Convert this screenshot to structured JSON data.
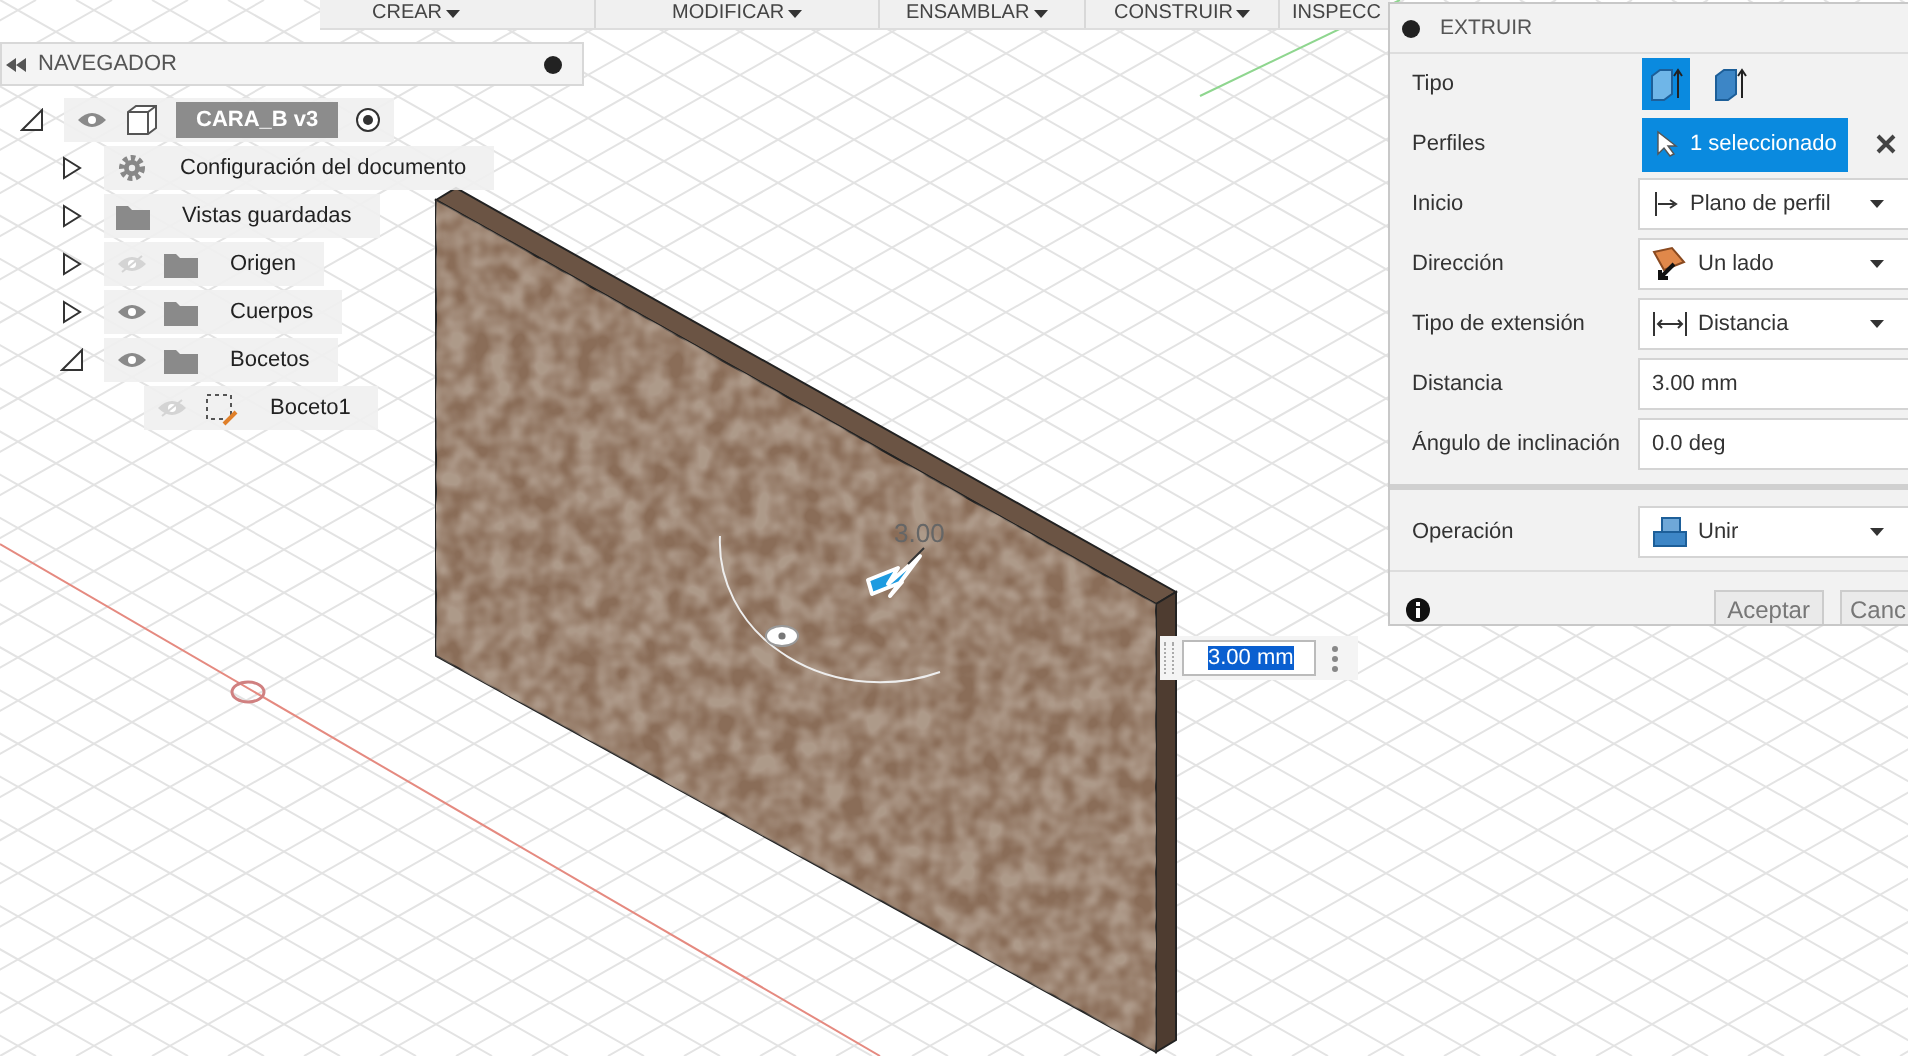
{
  "toolbar": {
    "menus": [
      {
        "label": "CREAR",
        "caret": true
      },
      {
        "label": "MODIFICAR",
        "caret": true
      },
      {
        "label": "ENSAMBLAR",
        "caret": true
      },
      {
        "label": "CONSTRUIR",
        "caret": true
      },
      {
        "label": "INSPECC",
        "caret": false
      }
    ]
  },
  "navigator": {
    "title": "NAVEGADOR",
    "tree": [
      {
        "label": "CARA_B v3",
        "kind": "component",
        "expanded": true,
        "visible": true,
        "active": true,
        "children": [
          {
            "label": "Configuración del documento",
            "kind": "settings",
            "expanded": false
          },
          {
            "label": "Vistas guardadas",
            "kind": "folder",
            "expanded": false
          },
          {
            "label": "Origen",
            "kind": "folder",
            "expanded": false,
            "visible": false
          },
          {
            "label": "Cuerpos",
            "kind": "folder",
            "expanded": false,
            "visible": true
          },
          {
            "label": "Bocetos",
            "kind": "folder",
            "expanded": true,
            "visible": true,
            "children": [
              {
                "label": "Boceto1",
                "kind": "sketch",
                "visible": false
              }
            ]
          }
        ]
      }
    ]
  },
  "viewport": {
    "dimension_label": "3.00",
    "distance_input": {
      "value": "3.00 mm"
    }
  },
  "extrude_panel": {
    "title": "EXTRUIR",
    "rows": [
      {
        "kind": "toggle",
        "label": "Tipo",
        "options": [
          {
            "selected": true
          },
          {
            "selected": false
          }
        ]
      },
      {
        "kind": "selection",
        "label": "Perfiles",
        "value": "1 seleccionado"
      },
      {
        "kind": "dropdown",
        "label": "Inicio",
        "value": "Plano de perfil"
      },
      {
        "kind": "dropdown",
        "label": "Dirección",
        "value": "Un lado"
      },
      {
        "kind": "dropdown",
        "label": "Tipo de extensión",
        "value": "Distancia"
      },
      {
        "kind": "input",
        "label": "Distancia",
        "value": "3.00 mm"
      },
      {
        "kind": "input",
        "label": "Ángulo de inclinación",
        "value": "0.0 deg"
      },
      {
        "kind": "separator"
      },
      {
        "kind": "dropdown",
        "label": "Operación",
        "value": "Unir"
      }
    ],
    "buttons": [
      "Aceptar",
      "Canc"
    ]
  }
}
